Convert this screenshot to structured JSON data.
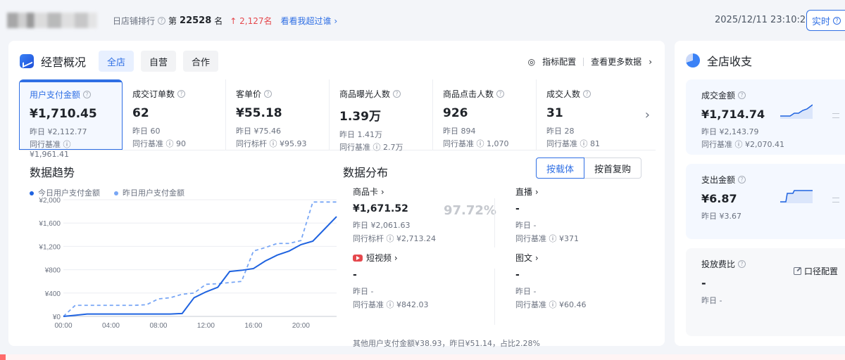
{
  "topbar": {
    "shop_rank_prefix": "日店铺排行",
    "rank_label": "第",
    "rank_number": "22528",
    "rank_suffix": "名",
    "rank_change": "↑ 2,127名",
    "surpass_link": "看看我超过谁 ›",
    "timestamp": "2025/12/11 23:10:29",
    "realtime_label": "实时"
  },
  "overview": {
    "title": "经营概况",
    "segments": [
      "全店",
      "自营",
      "合作"
    ],
    "active_segment": "全店",
    "metric_config": "指标配置",
    "more_data": "查看更多数据",
    "metrics": [
      {
        "label": "用户支付金额",
        "value": "¥1,710.45",
        "sub1": "昨日 ¥2,112.77",
        "sub2": "同行基准 ⓘ ¥1,961.41",
        "active": true
      },
      {
        "label": "成交订单数",
        "value": "62",
        "sub1": "昨日 60",
        "sub2": "同行基准 ⓘ 90",
        "active": false
      },
      {
        "label": "客单价",
        "value": "¥55.18",
        "sub1": "昨日 ¥75.46",
        "sub2": "同行标杆 ⓘ ¥95.93",
        "active": false
      },
      {
        "label": "商品曝光人数",
        "value": "1.39万",
        "sub1": "昨日 1.41万",
        "sub2": "同行基准 ⓘ 2.7万",
        "active": false
      },
      {
        "label": "商品点击人数",
        "value": "926",
        "sub1": "昨日 894",
        "sub2": "同行基准 ⓘ 1,070",
        "active": false
      },
      {
        "label": "成交人数",
        "value": "31",
        "sub1": "昨日 28",
        "sub2": "同行基准 ⓘ 81",
        "active": false
      }
    ]
  },
  "trend": {
    "title": "数据趋势",
    "legend_today": "今日用户支付金额",
    "legend_yesterday": "昨日用户支付金额"
  },
  "distribution": {
    "title": "数据分布",
    "tabs": [
      "按载体",
      "按首复购"
    ],
    "percent": "97.72%",
    "cells": {
      "goods_card": {
        "title": "商品卡 ›",
        "value": "¥1,671.52",
        "sub1": "昨日 ¥2,061.63",
        "sub2": "同行标杆 ⓘ ¥2,713.24"
      },
      "live": {
        "title": "直播 ›",
        "value": "-",
        "sub1": "昨日 -",
        "sub2": "同行基准 ⓘ ¥371"
      },
      "short_video": {
        "title": "短视频 ›",
        "value": "-",
        "sub1": "昨日 -",
        "sub2": "同行基准 ⓘ ¥842.03"
      },
      "image_text": {
        "title": "图文 ›",
        "value": "-",
        "sub1": "昨日 -",
        "sub2": "同行基准 ⓘ ¥60.46"
      }
    },
    "other": "其他用户支付金额¥38.93，昨日¥51.14，占比2.28%"
  },
  "sidebar": {
    "title": "全店收支",
    "cards": [
      {
        "label": "成交金额",
        "value": "¥1,714.74",
        "sub1": "昨日 ¥2,143.79",
        "sub2": "同行基准 ⓘ ¥2,070.41"
      },
      {
        "label": "支出金额",
        "value": "¥6.87",
        "sub1": "昨日 ¥3.67",
        "sub2": ""
      },
      {
        "label": "投放费比",
        "value": "-",
        "sub1": "昨日 -",
        "sub2": ""
      }
    ],
    "config_label": "口径配置"
  },
  "colors": {
    "accent": "#2f6fe4",
    "up": "#e5484d",
    "today_line": "#1f63e0",
    "yesterday_line": "#78a6f5"
  },
  "chart_data": {
    "type": "line",
    "x": [
      "00:00",
      "01:00",
      "02:00",
      "03:00",
      "04:00",
      "05:00",
      "06:00",
      "07:00",
      "08:00",
      "09:00",
      "10:00",
      "11:00",
      "12:00",
      "13:00",
      "14:00",
      "15:00",
      "16:00",
      "17:00",
      "18:00",
      "19:00",
      "20:00",
      "21:00",
      "22:00",
      "23:00"
    ],
    "series": [
      {
        "name": "今日用户支付金额",
        "values": [
          0,
          20,
          40,
          40,
          40,
          40,
          40,
          40,
          40,
          40,
          50,
          320,
          420,
          500,
          770,
          790,
          820,
          950,
          1050,
          1120,
          1230,
          1290,
          1500,
          1710
        ]
      },
      {
        "name": "昨日用户支付金额",
        "values": [
          0,
          190,
          190,
          190,
          190,
          190,
          190,
          200,
          300,
          320,
          380,
          400,
          550,
          560,
          580,
          600,
          1120,
          1180,
          1250,
          1250,
          1300,
          1960,
          1960,
          1960
        ]
      }
    ],
    "xticks": [
      "00:00",
      "04:00",
      "08:00",
      "12:00",
      "16:00",
      "20:00"
    ],
    "yticks": [
      "¥0",
      "¥400",
      "¥800",
      "¥1,200",
      "¥1,600",
      "¥2,000"
    ],
    "ylim": [
      0,
      2000
    ],
    "grid": true,
    "legend": "top-left"
  }
}
